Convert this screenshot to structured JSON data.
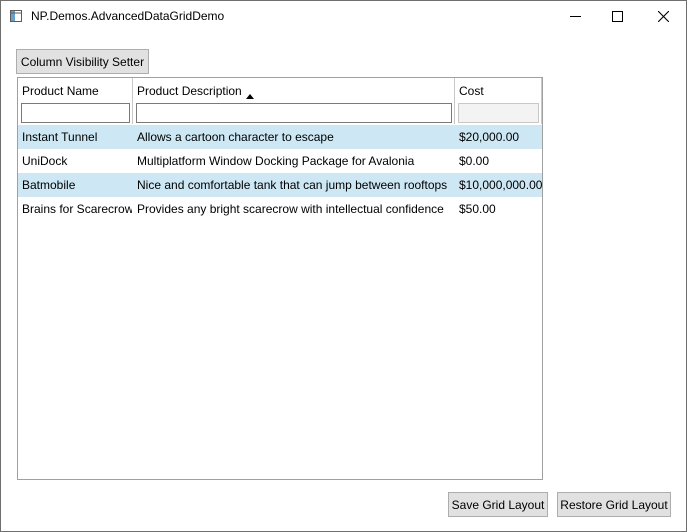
{
  "window": {
    "title": "NP.Demos.AdvancedDataGridDemo"
  },
  "toolbar": {
    "column_visibility_label": "Column Visibility Setter"
  },
  "grid": {
    "columns": [
      {
        "label": "Product Name",
        "sort": ""
      },
      {
        "label": "Product Description",
        "sort": "ascending"
      },
      {
        "label": "Cost",
        "sort": ""
      }
    ],
    "filters": [
      "",
      "",
      ""
    ],
    "rows": [
      {
        "name": "Instant Tunnel",
        "description": "Allows a cartoon character to escape",
        "cost": "$20,000.00",
        "selected": true
      },
      {
        "name": "UniDock",
        "description": "Multiplatform Window Docking Package for Avalonia",
        "cost": "$0.00",
        "selected": false
      },
      {
        "name": "Batmobile",
        "description": "Nice and comfortable tank that can jump between rooftops",
        "cost": "$10,000,000.00",
        "selected": true
      },
      {
        "name": "Brains for Scarecrow",
        "description": "Provides any bright scarecrow with intellectual confidence",
        "cost": "$50.00",
        "selected": false
      }
    ]
  },
  "footer": {
    "save_label": "Save Grid Layout",
    "restore_label": "Restore Grid Layout"
  },
  "icons": {
    "app": "app-window-icon",
    "minimize": "minimize-icon",
    "maximize": "maximize-icon",
    "close": "close-icon",
    "sort": "sort-ascending-icon"
  },
  "colors": {
    "selected_row": "#cde8f4",
    "button_face": "#e1e1e1"
  }
}
